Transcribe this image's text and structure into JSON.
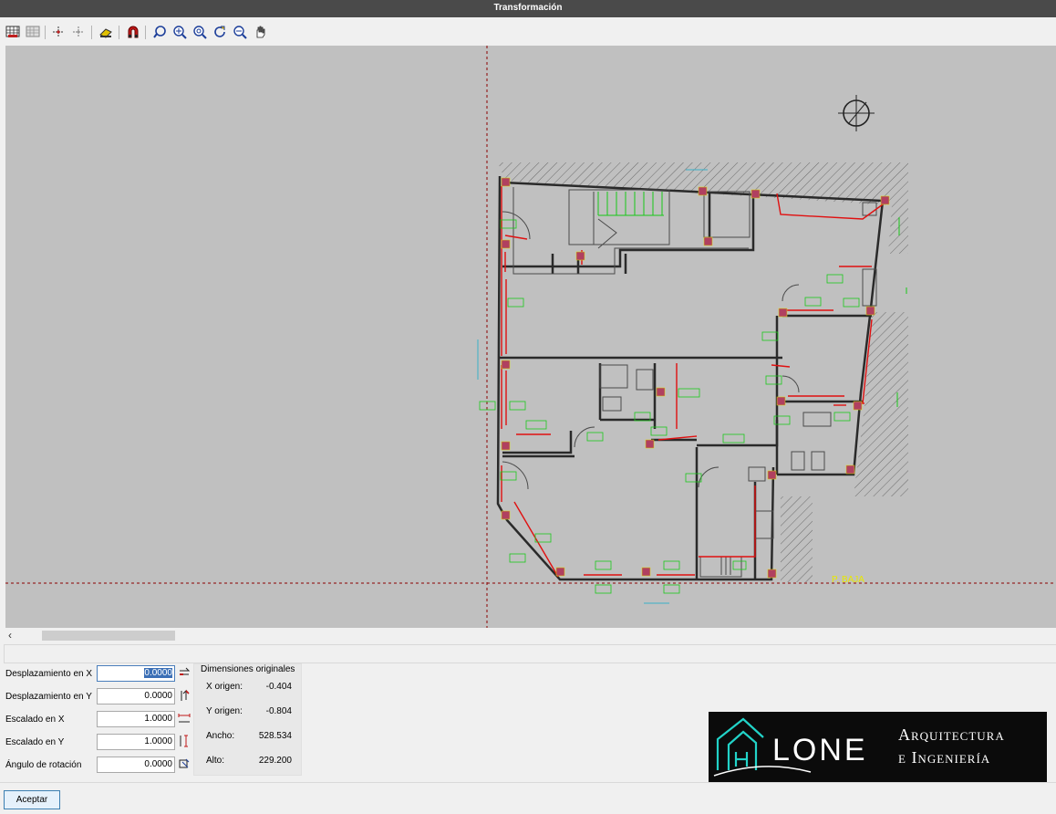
{
  "window": {
    "title": "Transformación"
  },
  "toolbar": {
    "icons": [
      "grid-icon",
      "grid-disabled-icon",
      "snap-points-icon",
      "snap-points-off-icon",
      "eraser-icon",
      "magnet-icon",
      "zoom-previous-icon",
      "zoom-window-icon",
      "zoom-extents-icon",
      "refresh-icon",
      "zoom-out-icon",
      "pan-icon"
    ]
  },
  "drawing": {
    "label_planta": "P. BAJA"
  },
  "form": {
    "desp_x": {
      "label": "Desplazamiento en X",
      "value": "0.0000"
    },
    "desp_y": {
      "label": "Desplazamiento en Y",
      "value": "0.0000"
    },
    "esc_x": {
      "label": "Escalado en X",
      "value": "1.0000"
    },
    "esc_y": {
      "label": "Escalado en Y",
      "value": "1.0000"
    },
    "angulo": {
      "label": "Ángulo de rotación",
      "value": "0.0000"
    }
  },
  "dims": {
    "header": "Dimensiones originales",
    "x_origen": {
      "label": "X origen:",
      "value": "-0.404"
    },
    "y_origen": {
      "label": "Y origen:",
      "value": "-0.804"
    },
    "ancho": {
      "label": "Ancho:",
      "value": "528.534"
    },
    "alto": {
      "label": "Alto:",
      "value": "229.200"
    }
  },
  "buttons": {
    "aceptar": "Aceptar"
  },
  "logo": {
    "brand": "LONE",
    "line1": "Arquitectura",
    "line2": "e Ingeniería"
  },
  "colors": {
    "titlebar": "#4a4a4a",
    "canvas": "#c0c0c0",
    "wall_red": "#e01010",
    "label_green": "#19c819",
    "axis_red": "#8b0000",
    "logo_teal": "#22d3c8"
  }
}
